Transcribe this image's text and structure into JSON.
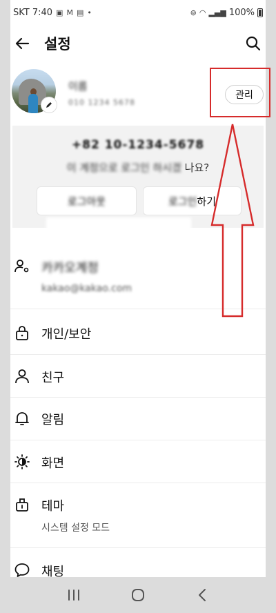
{
  "status_bar": {
    "carrier_time": "SKT 7:40",
    "dot": "•",
    "battery_pct": "100%"
  },
  "header": {
    "title": "설정"
  },
  "profile": {
    "name_blurred": "이름",
    "sub_blurred": "010 1234 5678",
    "manage_label": "관리"
  },
  "login_card": {
    "number_blurred": "+82 10-1234-5678",
    "question_blurred": "이 계정으로 로그인 하시겠",
    "question_visible": "나요?",
    "btn_left_blurred": "로그아웃",
    "btn_right_blurred": "로그인",
    "btn_right_visible": "하기"
  },
  "menu": {
    "items": [
      {
        "label_blurred": "카카오계정",
        "sub_blurred": "kakao@kakao.com",
        "icon": "person-gear-icon"
      },
      {
        "label": "개인/보안",
        "icon": "lock-icon"
      },
      {
        "label": "친구",
        "icon": "person-icon"
      },
      {
        "label": "알림",
        "icon": "bell-icon"
      },
      {
        "label": "화면",
        "icon": "brightness-icon"
      },
      {
        "label": "테마",
        "sub": "시스템 설정 모드",
        "icon": "theme-icon"
      },
      {
        "label": "채팅",
        "icon": "chat-bubble-icon"
      }
    ]
  },
  "colors": {
    "annotation_red": "#d62b2b",
    "card_bg": "#f2f2f2",
    "nav_bg": "#dcdcdc"
  }
}
